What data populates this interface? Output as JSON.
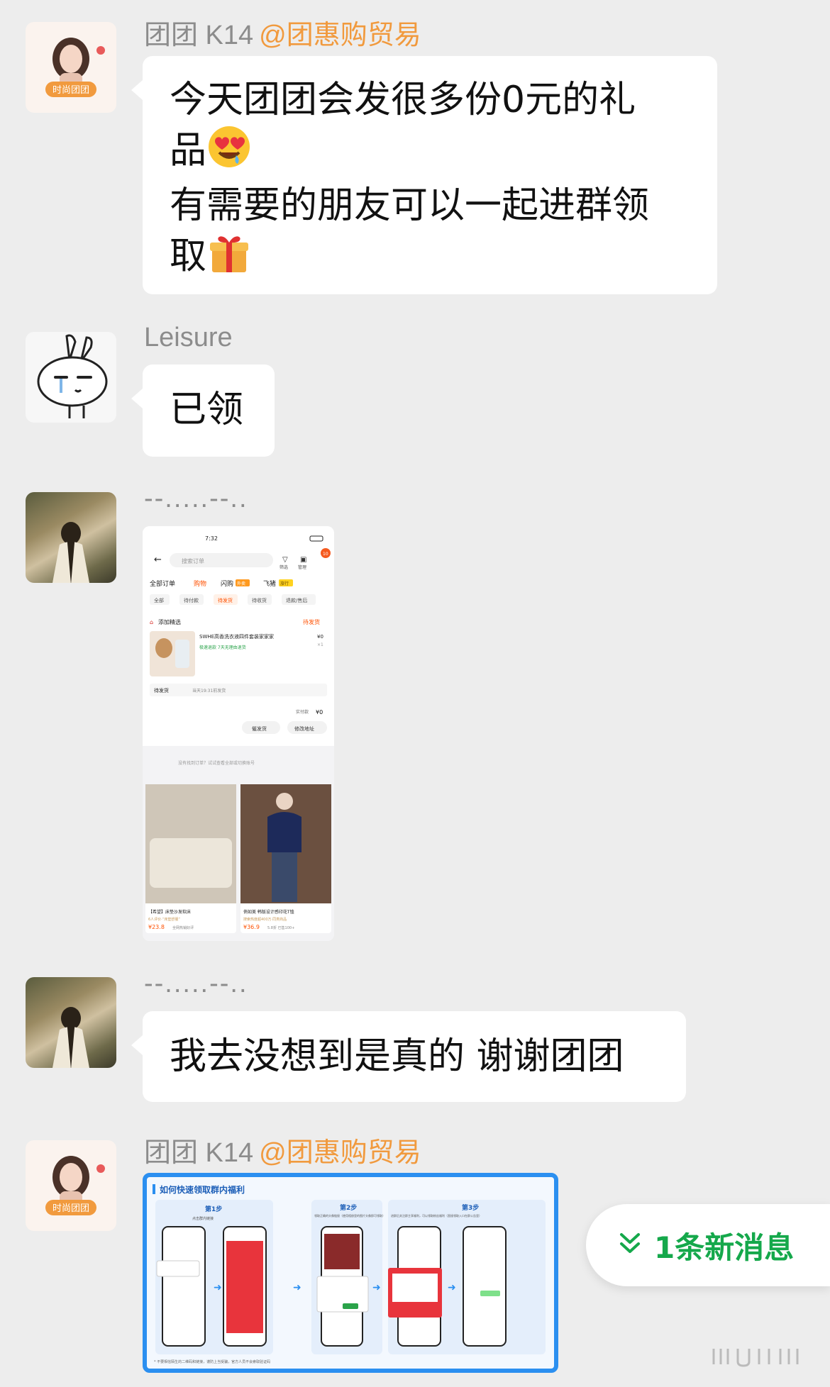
{
  "messages": [
    {
      "sender": "团团 K14",
      "tag": "@团惠购贸易",
      "lines": [
        "今天团团会发很多份0元的礼",
        "品",
        "有需要的朋友可以一起进群领",
        "取"
      ],
      "emojis": [
        "heart-eyes-emoji",
        "gift-emoji"
      ]
    },
    {
      "sender": "Leisure",
      "text": "已领"
    },
    {
      "sender": "--.....--..",
      "screenshot": {
        "time": "7:32",
        "search_placeholder": "搜索订单",
        "filter_label": "筛选",
        "manage_label": "管理",
        "badge": "10",
        "tabs": [
          "全部订单",
          "购物",
          "闪购",
          "飞猪"
        ],
        "tab_badges": [
          "外卖",
          "旅行"
        ],
        "status_tabs": [
          "全部",
          "待付款",
          "待发货",
          "待收货",
          "退款/售后"
        ],
        "store_name": "添加精选",
        "status": "待发货",
        "product_title": "SWHE高香洗衣液四件套装家家家",
        "product_price": "¥0",
        "product_qty": "×1",
        "product_sub": "极速退款 7天无理由退货",
        "ship_label": "待发货",
        "ship_note": "当天19:31前发货",
        "paid_label": "实付款",
        "paid_value": "¥0",
        "btn_remind": "催发货",
        "btn_address": "修改地址",
        "recommend_hint": "没有找到订单？试试查看全部或切换账号",
        "products": [
          {
            "title": "【希望】床垫沙发软床",
            "note": "6人评价·“床垫舒服”",
            "price": "¥23.8",
            "extra": "全网热销好评"
          },
          {
            "title": "俏如美 韩版设计感印花T恤",
            "note": "搜索热度超400万·同类商品",
            "price": "¥36.9",
            "extra": "5.8折 已售100+"
          }
        ]
      }
    },
    {
      "sender": "--.....--..",
      "text": "我去没想到是真的 谢谢团团"
    },
    {
      "sender": "团团 K14",
      "tag": "@团惠购贸易",
      "guide": {
        "title": "如何快速领取群内福利",
        "steps": [
          "第1步",
          "第2步",
          "第3步"
        ],
        "step_desc": [
          "点击群内链接",
          "领取正确的头像链接（使用相册里的图片头像即可领取）",
          "进群后关注群主享福利，可以领取粉丝福利（直接领取入口在群公告里）"
        ],
        "footer": "* 不要相信陌生的二维码和链接，谨防上当受骗，官方人员不会索取验证码"
      }
    }
  ],
  "new_message": "1条新消息",
  "colors": {
    "tag": "#f19a3e",
    "new_message": "#15a84b",
    "guide_border": "#2b8ff0"
  }
}
